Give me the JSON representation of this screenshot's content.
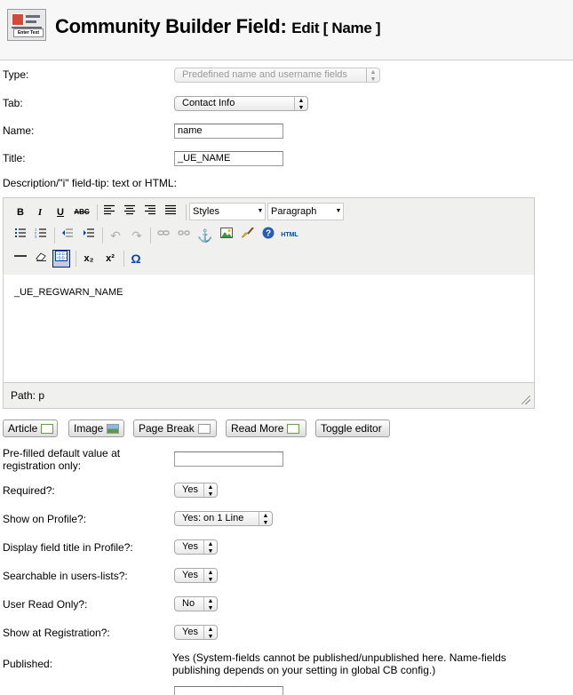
{
  "header": {
    "title": "Community Builder Field:",
    "subtitle": "Edit [ Name ]",
    "icon_caption": "Enter Text"
  },
  "form": {
    "type": {
      "label": "Type:",
      "value": "Predefined name and username fields"
    },
    "tab": {
      "label": "Tab:",
      "value": "Contact Info"
    },
    "name": {
      "label": "Name:",
      "value": "name"
    },
    "title": {
      "label": "Title:",
      "value": "_UE_NAME"
    },
    "description": {
      "label": "Description/\"i\" field-tip: text or HTML:"
    }
  },
  "editor": {
    "styles_select": "Styles",
    "format_select": "Paragraph",
    "content": "_UE_REGWARN_NAME",
    "path": "Path: p",
    "toolbar_icons": {
      "bold": "B",
      "italic": "I",
      "underline": "U",
      "strike": "ABC",
      "html": "HTML",
      "sub": "x₂",
      "sup": "x²",
      "omega": "Ω"
    }
  },
  "editor_buttons": {
    "article": "Article",
    "image": "Image",
    "page_break": "Page Break",
    "read_more": "Read More",
    "toggle": "Toggle editor"
  },
  "fields": {
    "prefilled": {
      "label": "Pre-filled default value at registration only:",
      "value": ""
    },
    "required": {
      "label": "Required?:",
      "value": "Yes"
    },
    "show_on_profile": {
      "label": "Show on Profile?:",
      "value": "Yes: on 1 Line"
    },
    "display_title": {
      "label": "Display field title in Profile?:",
      "value": "Yes"
    },
    "searchable": {
      "label": "Searchable in users-lists?:",
      "value": "Yes"
    },
    "user_read_only": {
      "label": "User Read Only?:",
      "value": "No"
    },
    "show_at_registration": {
      "label": "Show at Registration?:",
      "value": "Yes"
    },
    "published": {
      "label": "Published:",
      "value": "Yes (System-fields cannot be published/unpublished here. Name-fields publishing depends on your setting in global CB config.)"
    }
  },
  "colors": {
    "header_bg": "#f7f7f7",
    "editor_bg": "#f0f0ee"
  }
}
